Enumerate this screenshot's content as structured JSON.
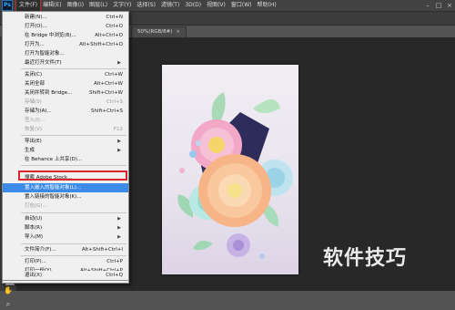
{
  "app": {
    "logo": "Ps"
  },
  "menubar": {
    "items": [
      "文件(F)",
      "编辑(E)",
      "图像(I)",
      "图层(L)",
      "文字(Y)",
      "选择(S)",
      "滤镜(T)",
      "3D(D)",
      "视图(V)",
      "窗口(W)",
      "帮助(H)"
    ]
  },
  "document": {
    "tab_label": "50%(RGB/8#)"
  },
  "file_menu": {
    "items": [
      {
        "label": "新建(N)...",
        "shortcut": "Ctrl+N"
      },
      {
        "label": "打开(O)...",
        "shortcut": "Ctrl+O"
      },
      {
        "label": "在 Bridge 中浏览(B)...",
        "shortcut": "Alt+Ctrl+O"
      },
      {
        "label": "打开为...",
        "shortcut": "Alt+Shift+Ctrl+O"
      },
      {
        "label": "打开为智能对象...",
        "shortcut": ""
      },
      {
        "label": "最近打开文件(T)",
        "shortcut": ""
      },
      {
        "label": "关闭(C)",
        "shortcut": "Ctrl+W"
      },
      {
        "label": "关闭全部",
        "shortcut": "Alt+Ctrl+W"
      },
      {
        "label": "关闭并转到 Bridge...",
        "shortcut": "Shift+Ctrl+W"
      },
      {
        "label": "存储(S)",
        "shortcut": "Ctrl+S"
      },
      {
        "label": "存储为(A)...",
        "shortcut": "Shift+Ctrl+S"
      },
      {
        "label": "签入(I)...",
        "shortcut": ""
      },
      {
        "label": "恢复(V)",
        "shortcut": "F12"
      },
      {
        "label": "导出(E)",
        "shortcut": ""
      },
      {
        "label": "生成",
        "shortcut": ""
      },
      {
        "label": "在 Behance 上共享(D)...",
        "shortcut": ""
      },
      {
        "label": "搜索 Adobe Stock...",
        "shortcut": ""
      },
      {
        "label": "置入嵌入的智能对象(L)...",
        "shortcut": ""
      },
      {
        "label": "置入链接的智能对象(K)...",
        "shortcut": ""
      },
      {
        "label": "打包(G)...",
        "shortcut": ""
      },
      {
        "label": "自动(U)",
        "shortcut": ""
      },
      {
        "label": "脚本(R)",
        "shortcut": ""
      },
      {
        "label": "导入(M)",
        "shortcut": ""
      },
      {
        "label": "文件简介(F)...",
        "shortcut": "Alt+Shift+Ctrl+I"
      },
      {
        "label": "打印(P)...",
        "shortcut": "Ctrl+P"
      },
      {
        "label": "打印一份(Y)",
        "shortcut": "Alt+Shift+Ctrl+P"
      },
      {
        "label": "退出(X)",
        "shortcut": "Ctrl+Q"
      }
    ]
  },
  "watermark": "软件技巧",
  "colors": {
    "highlight": "#3c8ce7",
    "annotation": "#d9232d",
    "foreground": "#f09a3a"
  }
}
